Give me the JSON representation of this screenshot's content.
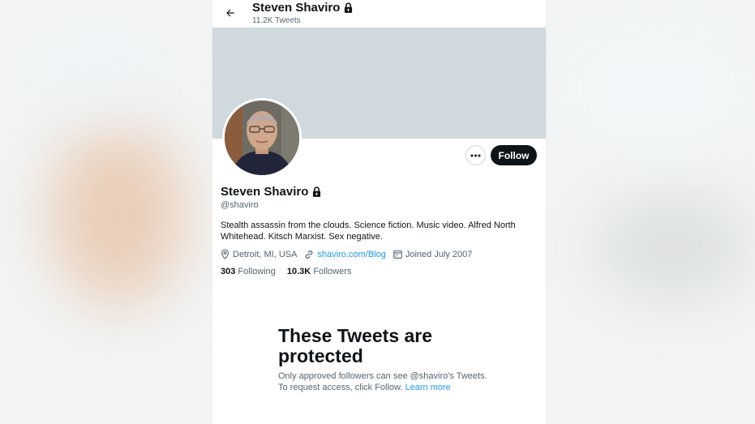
{
  "colors": {
    "accent_link": "#1d9bf0",
    "text_primary": "#0f1419",
    "text_secondary": "#536471",
    "banner": "#cfd9de",
    "follow_bg": "#0f1419"
  },
  "header": {
    "back_icon": "arrow-left-icon",
    "title": "Steven Shaviro",
    "lock_icon": "lock-icon",
    "tweet_count": "11.2K Tweets"
  },
  "profile": {
    "name": "Steven Shaviro",
    "handle": "@shaviro",
    "bio": "Stealth assassin from the clouds. Science fiction. Music video. Alfred North Whitehead. Kitsch Marxist. Sex negative.",
    "location": "Detroit, MI, USA",
    "website": "shaviro.com/Blog",
    "joined": "Joined July 2007",
    "following_count": "303",
    "following_label": "Following",
    "followers_count": "10.3K",
    "followers_label": "Followers"
  },
  "actions": {
    "more_icon": "more-horizontal-icon",
    "follow_label": "Follow"
  },
  "protected": {
    "title": "These Tweets are protected",
    "text": "Only approved followers can see @shaviro's Tweets. To request access, click Follow.",
    "learn_more": "Learn more"
  }
}
